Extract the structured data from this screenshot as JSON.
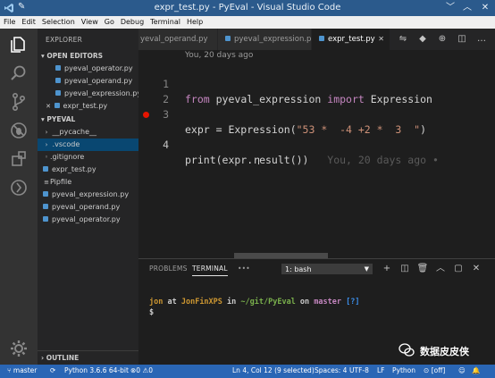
{
  "window": {
    "title": "expr_test.py - PyEval - Visual Studio Code",
    "buttons": [
      "﹀",
      "︿",
      "✕"
    ]
  },
  "menu": [
    "File",
    "Edit",
    "Selection",
    "View",
    "Go",
    "Debug",
    "Terminal",
    "Help"
  ],
  "activity": [
    "explorer-icon",
    "search-icon",
    "source-control-icon",
    "debug-icon",
    "extensions-icon",
    "remote-icon",
    "settings-gear-icon"
  ],
  "sidebar": {
    "title": "EXPLORER",
    "open_editors": {
      "label": "OPEN EDITORS",
      "items": [
        "pyeval_operator.py",
        "pyeval_operand.py",
        "pyeval_expression.py",
        "expr_test.py"
      ]
    },
    "project": {
      "label": "PYEVAL",
      "items": [
        "__pycache__",
        ".vscode",
        ".gitignore",
        "expr_test.py",
        "Pipfile",
        "pyeval_expression.py",
        "pyeval_operand.py",
        "pyeval_operator.py"
      ]
    },
    "outline": "OUTLINE"
  },
  "tabs": [
    "yeval_operand.py",
    "pyeval_expression.py",
    "expr_test.py"
  ],
  "editor": {
    "codelens": "You, 20 days ago",
    "line_numbers": [
      "1",
      "2",
      "3",
      "4"
    ],
    "line1": {
      "from": "from",
      "module": " pyeval_expression ",
      "import": "import",
      "name": " Expression"
    },
    "line3": {
      "lhs": "expr = Expression(",
      "str": "\"53 *  -4 +2 *  3  \"",
      "rhs": ")"
    },
    "line4": {
      "code": "print(expr.result())",
      "blame": "You, 20 days ago •"
    },
    "cursor_glyph": "I"
  },
  "panel": {
    "tabs": [
      "PROBLEMS",
      "TERMINAL",
      "•••"
    ],
    "terminal_select": "1: bash",
    "terminal": {
      "user": "jon",
      "at": " at ",
      "host": "JonFinXPS",
      "in": " in ",
      "path": "~/git/PyEval",
      "on": " on ",
      "branch": "master",
      "status": "[?]",
      "prompt": "$"
    }
  },
  "statusbar": {
    "branch": "master",
    "python": "Python 3.6.6 64-bit",
    "errors": "0",
    "warnings": "0",
    "position": "Ln 4, Col 12 (9 selected)",
    "spaces": "Spaces: 4",
    "encoding": "UTF-8",
    "eol": "LF",
    "language": "Python",
    "live": "[off]"
  },
  "watermark": "数据皮皮侠",
  "colors": {
    "accent": "#2a66b5",
    "keyword": "#c586c0",
    "string": "#ce9178",
    "breakpoint": "#e51400"
  }
}
